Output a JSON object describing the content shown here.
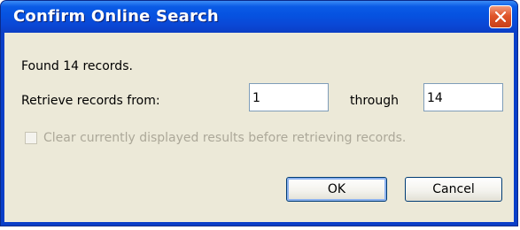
{
  "window": {
    "title": "Confirm Online Search",
    "close_icon": "close-icon"
  },
  "content": {
    "found_text": "Found 14 records.",
    "retrieve_label": "Retrieve records from:",
    "from_value": "1",
    "through_label": "through",
    "through_value": "14",
    "clear_checkbox": {
      "label": "Clear currently displayed results before retrieving records.",
      "checked": false,
      "enabled": false
    }
  },
  "buttons": {
    "ok_label": "OK",
    "cancel_label": "Cancel"
  },
  "colors": {
    "titlebar": "#0a48d6",
    "dialog_bg": "#ece9d8",
    "close_button": "#e0552a",
    "disabled_text": "#aca899"
  }
}
